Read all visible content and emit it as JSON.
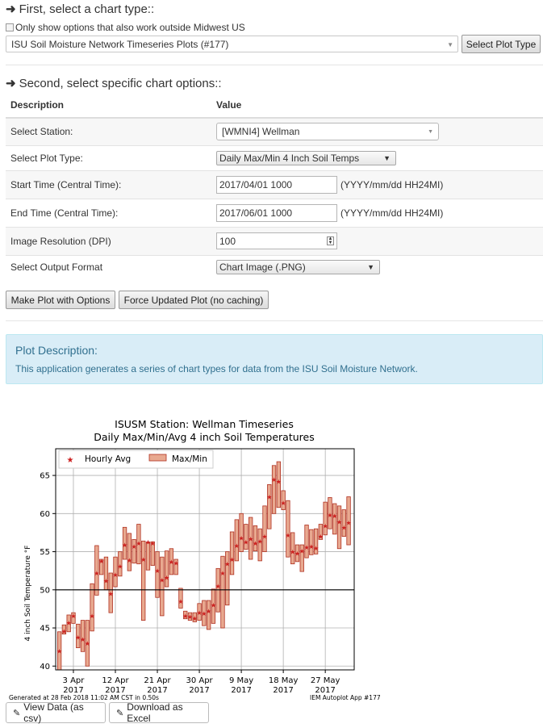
{
  "step1": {
    "title": "First, select a chart type::",
    "checkbox_label": "Only show options that also work outside Midwest US",
    "chart_type_selected": "ISU Soil Moisture Network Timeseries Plots (#177)",
    "select_button": "Select Plot Type"
  },
  "step2": {
    "title": "Second, select specific chart options::",
    "col_description": "Description",
    "col_value": "Value",
    "rows": {
      "station": {
        "label": "Select Station:",
        "value": "[WMNI4] Wellman"
      },
      "plot_type": {
        "label": "Select Plot Type:",
        "value": "Daily Max/Min 4 Inch Soil Temps"
      },
      "start": {
        "label": "Start Time (Central Time):",
        "value": "2017/04/01 1000",
        "hint": "(YYYY/mm/dd HH24MI)"
      },
      "end": {
        "label": "End Time (Central Time):",
        "value": "2017/06/01 1000",
        "hint": "(YYYY/mm/dd HH24MI)"
      },
      "dpi": {
        "label": "Image Resolution (DPI)",
        "value": "100"
      },
      "format": {
        "label": "Select Output Format",
        "value": "Chart Image (.PNG)"
      }
    },
    "make_plot_button": "Make Plot with Options",
    "force_button": "Force Updated Plot (no caching)"
  },
  "description": {
    "title": "Plot Description:",
    "text": "This application generates a series of chart types for data from the ISU Soil Moisture Network."
  },
  "footer_buttons": {
    "view_data": "View Data (as csv)",
    "download_excel": "Download as Excel"
  },
  "colors": {
    "bar_fill": "#e8a990",
    "bar_edge": "#b03020",
    "avg_marker": "#cc1f1f",
    "panel_bg": "#d9edf7",
    "panel_text": "#31708f"
  },
  "chart_data": {
    "type": "bar",
    "title": "ISUSM Station: Wellman Timeseries",
    "subtitle": "Daily Max/Min/Avg 4 inch Soil Temperatures",
    "xlabel": "",
    "ylabel": "4 inch Soil Temperature °F",
    "ylim": [
      39.5,
      68.5
    ],
    "yticks": [
      40,
      45,
      50,
      55,
      60,
      65
    ],
    "xticks": [
      {
        "day": 3,
        "line1": "3 Apr",
        "line2": "2017"
      },
      {
        "day": 12,
        "line1": "12 Apr",
        "line2": "2017"
      },
      {
        "day": 21,
        "line1": "21 Apr",
        "line2": "2017"
      },
      {
        "day": 30,
        "line1": "30 Apr",
        "line2": "2017"
      },
      {
        "day": 39,
        "line1": "9 May",
        "line2": "2017"
      },
      {
        "day": 48,
        "line1": "18 May",
        "line2": "2017"
      },
      {
        "day": 57,
        "line1": "27 May",
        "line2": "2017"
      }
    ],
    "xlim": [
      -0.8,
      63.2
    ],
    "grid": true,
    "legend_position": "top-left",
    "legend": [
      "Hourly Avg",
      "Max/Min"
    ],
    "reference_line": 50,
    "series": [
      {
        "name": "Max/Min",
        "min": [
          39.5,
          44.2,
          44.5,
          45.6,
          42.4,
          41.9,
          40.0,
          44.6,
          49.3,
          52.0,
          50.0,
          47.0,
          50.4,
          51.8,
          54.0,
          52.5,
          53.5,
          53.4,
          46.0,
          52.6,
          53.2,
          49.0,
          46.6,
          50.4,
          52.0,
          52.0,
          47.6,
          46.2,
          46.0,
          45.8,
          46.0,
          45.3,
          44.8,
          45.6,
          47.1,
          45.0,
          48.0,
          52.0,
          53.8,
          55.0,
          55.3,
          54.0,
          55.1,
          53.8,
          55.0,
          58.0,
          60.0,
          60.8,
          60.5,
          54.3,
          53.4,
          53.7,
          52.4,
          54.2,
          54.6,
          54.7,
          56.6,
          57.2,
          58.0,
          57.3,
          55.4,
          57.0,
          55.9
        ],
        "max": [
          44.5,
          45.4,
          46.7,
          47.0,
          45.5,
          46.0,
          46.0,
          50.8,
          55.8,
          54.0,
          54.3,
          52.2,
          54.3,
          55.0,
          58.2,
          57.4,
          56.6,
          58.6,
          56.4,
          56.2,
          56.3,
          55.0,
          54.3,
          55.1,
          55.4,
          54.0,
          50.2,
          47.2,
          47.0,
          47.0,
          48.2,
          48.6,
          48.6,
          50.1,
          52.8,
          54.4,
          55.0,
          57.6,
          59.2,
          60.0,
          58.6,
          59.5,
          58.4,
          58.0,
          61.0,
          63.8,
          66.3,
          66.8,
          63.0,
          61.7,
          57.5,
          55.9,
          55.9,
          58.5,
          57.9,
          58.0,
          58.6,
          61.5,
          62.1,
          61.3,
          61.0,
          60.5,
          62.2
        ]
      },
      {
        "name": "Hourly Avg",
        "values": [
          42.0,
          44.6,
          45.7,
          46.6,
          43.8,
          43.5,
          43.0,
          46.6,
          52.2,
          53.8,
          51.2,
          49.5,
          52.0,
          53.1,
          55.9,
          53.9,
          55.7,
          56.1,
          54.0,
          56.3,
          56.1,
          52.5,
          51.3,
          51.6,
          53.7,
          53.5,
          48.5,
          46.6,
          46.5,
          46.3,
          47.0,
          46.9,
          47.2,
          48.0,
          50.5,
          52.2,
          53.4,
          54.0,
          55.8,
          56.8,
          56.3,
          56.7,
          56.1,
          56.4,
          57.0,
          62.2,
          64.5,
          64.2,
          61.4,
          57.2,
          55.0,
          54.8,
          55.1,
          55.6,
          55.7,
          55.5,
          57.0,
          58.4,
          59.8,
          59.7,
          58.9,
          58.2,
          58.8
        ]
      }
    ],
    "generated_note": "Generated at 28 Feb 2018 11:02 AM CST in 0.50s",
    "app_note": "IEM Autoplot App #177"
  }
}
